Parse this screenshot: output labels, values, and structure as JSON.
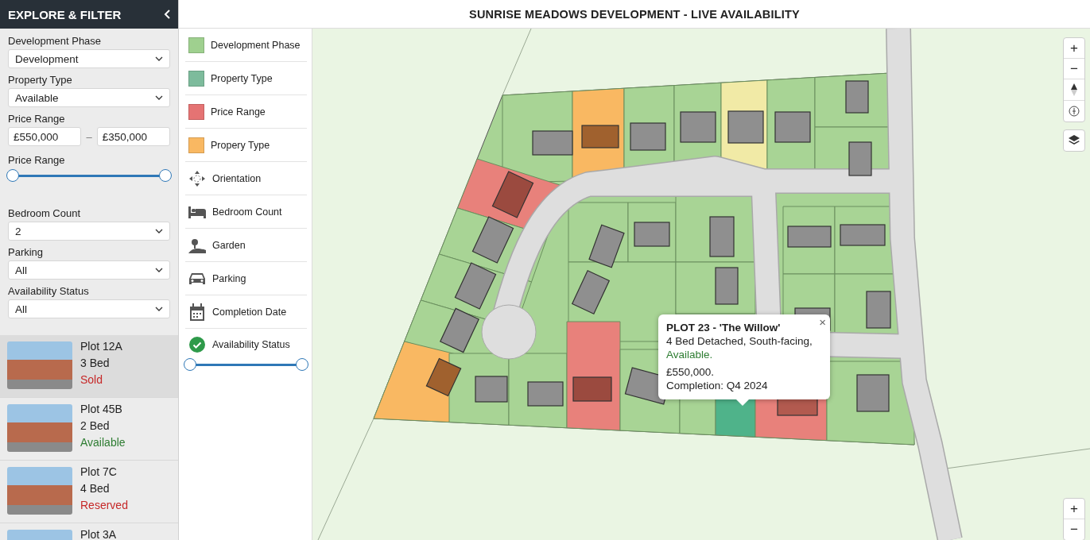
{
  "sidebar": {
    "title": "EXPLORE & FILTER",
    "filters": [
      {
        "kind": "select",
        "label": "Development Phase",
        "value": "Development"
      },
      {
        "kind": "select",
        "label": "Property Type",
        "value": "Available"
      },
      {
        "kind": "range_inputs",
        "label": "Price Range",
        "min": "£550,000",
        "separator": "–",
        "max": "£350,000"
      },
      {
        "kind": "slider",
        "label": "Price Range",
        "level": 1
      },
      {
        "kind": "select",
        "label": "Bedroom Count",
        "value": "2"
      },
      {
        "kind": "select",
        "label": "Parking",
        "value": "All"
      },
      {
        "kind": "select",
        "label": "Availability Status",
        "value": "All"
      }
    ],
    "listings": [
      {
        "title": "Plot 12A",
        "beds": "3 Bed",
        "status": "Sold",
        "color": "#c62828",
        "selected": true
      },
      {
        "title": "Plot 45B",
        "beds": "2 Bed",
        "status": "Available",
        "color": "#2e7d32",
        "selected": false
      },
      {
        "title": "Plot 7C",
        "beds": "4 Bed",
        "status": "Reserved",
        "color": "#c62828",
        "selected": false
      },
      {
        "title": "Plot 3A",
        "selected": false
      }
    ]
  },
  "header": {
    "title": "SUNRISE MEADOWS DEVELOPMENT - LIVE AVAILABILITY"
  },
  "legend": [
    {
      "kind": "swatch",
      "label": "Development Phase",
      "color": "#9fd08f"
    },
    {
      "kind": "swatch",
      "label": "Property Type",
      "color": "#7dbb9c"
    },
    {
      "kind": "swatch",
      "label": "Price Range",
      "color": "#e57373"
    },
    {
      "kind": "swatch",
      "label": "Propery Type",
      "color": "#f9b862"
    },
    {
      "kind": "icon",
      "label": "Orientation"
    },
    {
      "kind": "icon",
      "label": "Bedroom Count"
    },
    {
      "kind": "icon",
      "label": "Garden"
    },
    {
      "kind": "icon",
      "label": "Parking"
    },
    {
      "kind": "icon",
      "label": "Completion Date"
    },
    {
      "kind": "status_slider",
      "label": "Availability Status",
      "level": 1
    }
  ],
  "popup": {
    "title": "PLOT 23 - 'The Willow'",
    "description": "4 Bed Detached, South-facing,",
    "status": "Available.",
    "price": "£550,000.",
    "completion": "Completion: Q4 2024",
    "close": "×"
  },
  "map_controls": {
    "zoom_top": [
      "+",
      "−"
    ],
    "zoom_bottom": [
      "+",
      "−"
    ]
  }
}
